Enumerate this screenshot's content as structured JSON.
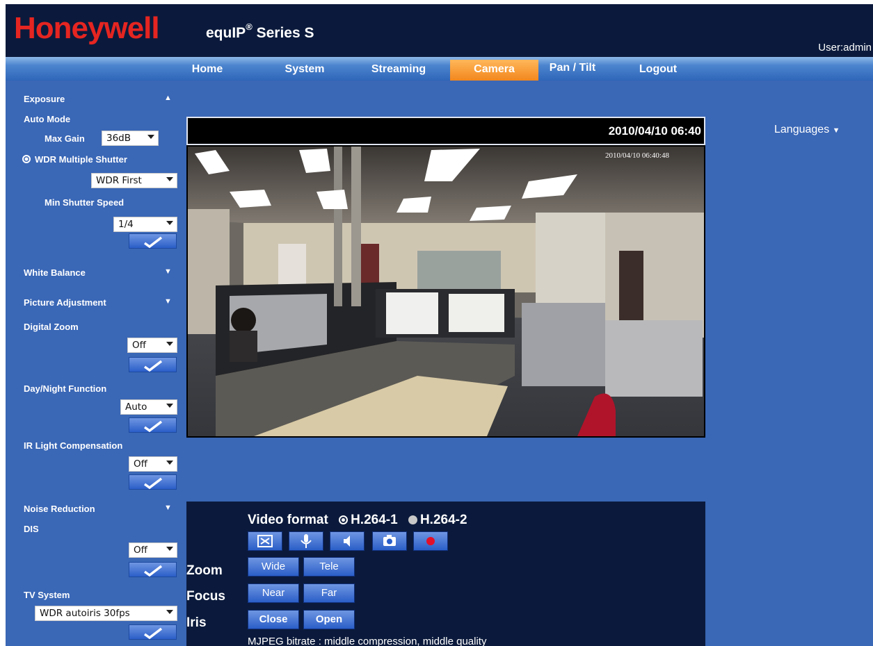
{
  "header": {
    "logo": "Honeywell",
    "product_name": "equIP",
    "product_reg": "®",
    "product_series": " Series S",
    "user": "User:admin"
  },
  "nav": [
    "Home",
    "System",
    "Streaming",
    "Camera",
    "Pan / Tilt",
    "Logout"
  ],
  "nav_active": "Camera",
  "sidebar": {
    "exposure": "Exposure",
    "auto_mode": "Auto Mode",
    "max_gain_label": "Max Gain",
    "max_gain_value": "36dB",
    "wdr_label": "WDR Multiple Shutter",
    "wdr_value": "WDR First",
    "min_shutter_label": "Min Shutter Speed",
    "min_shutter_value": "1/4",
    "white_balance": "White Balance",
    "picture_adjustment": "Picture Adjustment",
    "digital_zoom_label": "Digital Zoom",
    "digital_zoom_value": "Off",
    "day_night_label": "Day/Night Function",
    "day_night_value": "Auto",
    "ir_label": "IR Light Compensation",
    "ir_value": "Off",
    "noise_reduction": "Noise Reduction",
    "dis_label": "DIS",
    "dis_value": "Off",
    "tv_system_label": "TV System",
    "tv_system_value": "WDR autoiris 30fps"
  },
  "video": {
    "datetime": "2010/04/10 06:40",
    "overlay_timestamp": "2010/04/10 06:40:48"
  },
  "languages": "Languages",
  "controls": {
    "video_format_label": "Video format",
    "format_1": "H.264-1",
    "format_2": "H.264-2",
    "selected_format": "H.264-1",
    "zoom_label": "Zoom",
    "wide": "Wide",
    "tele": "Tele",
    "focus_label": "Focus",
    "near": "Near",
    "far": "Far",
    "iris_label": "Iris",
    "close": "Close",
    "open": "Open",
    "bitrate": "MJPEG bitrate : middle compression, middle quality"
  },
  "colors": {
    "header_bg": "#0b1a3c",
    "logo": "#e52521",
    "main_bg": "#3a67b6",
    "active_tab": "#f2871d"
  }
}
